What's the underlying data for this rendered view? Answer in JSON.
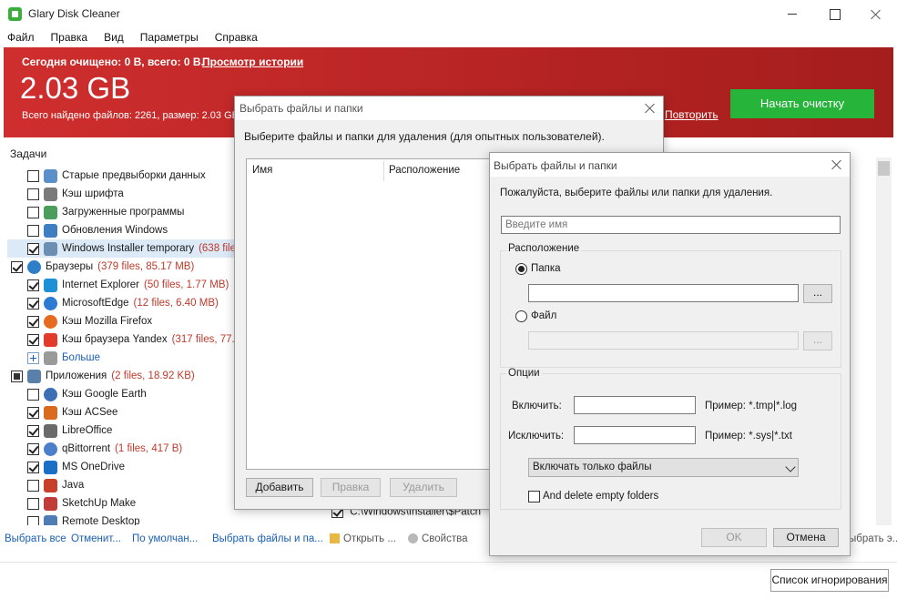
{
  "app": {
    "title": "Glary Disk Cleaner"
  },
  "menu": [
    "Файл",
    "Правка",
    "Вид",
    "Параметры",
    "Справка"
  ],
  "banner": {
    "today": "Сегодня очищено: 0 B, всего: 0 B.",
    "history_link": "Просмотр истории",
    "total_size": "2.03 GB",
    "found": "Всего найдено файлов: 2261, размер: 2.03 GB",
    "repeat_link": "Повторить",
    "start_button": "Начать очистку"
  },
  "tasks": {
    "header": "Задачи",
    "rows": [
      {
        "label": "Старые предвыборки данных",
        "count": "",
        "checked": false,
        "indent": 1,
        "icon": "prefetch-icon",
        "color": "#5b8fc9"
      },
      {
        "label": "Кэш шрифта",
        "count": "",
        "checked": false,
        "indent": 1,
        "icon": "font-icon",
        "color": "#7a7a7a"
      },
      {
        "label": "Загруженные программы",
        "count": "",
        "checked": false,
        "indent": 1,
        "icon": "download-icon",
        "color": "#4a9d5a"
      },
      {
        "label": "Обновления Windows",
        "count": "",
        "checked": false,
        "indent": 1,
        "icon": "windows-update-icon",
        "color": "#3f7fc1"
      },
      {
        "label": "Windows Installer temporary",
        "count": "(638 files,",
        "checked": true,
        "indent": 1,
        "icon": "installer-icon",
        "color": "#6a8fb3",
        "selected": true
      },
      {
        "label": "Браузеры",
        "count": "(379 files, 85.17 MB)",
        "checked": true,
        "indent": 0,
        "icon": "globe-icon",
        "color": "#2e7fc7"
      },
      {
        "label": "Internet Explorer",
        "count": "(50 files, 1.77 MB)",
        "checked": true,
        "indent": 1,
        "icon": "ie-icon",
        "color": "#1e90d6"
      },
      {
        "label": "MicrosoftEdge",
        "count": "(12 files, 6.40 MB)",
        "checked": true,
        "indent": 1,
        "icon": "edge-icon",
        "color": "#2a7bd1"
      },
      {
        "label": "Кэш Mozilla Firefox",
        "count": "",
        "checked": true,
        "indent": 1,
        "icon": "firefox-icon",
        "color": "#e66a1f"
      },
      {
        "label": "Кэш браузера Yandex",
        "count": "(317 files, 77.0",
        "checked": true,
        "indent": 1,
        "icon": "yandex-icon",
        "color": "#e23a2b"
      },
      {
        "label": "Больше",
        "count": "",
        "checked": null,
        "indent": 1,
        "icon": "more-icon",
        "color": "#9a9a9a",
        "link": true
      },
      {
        "label": "Приложения",
        "count": "(2 files, 18.92 KB)",
        "checked": "partial",
        "indent": 0,
        "icon": "apps-icon",
        "color": "#5a7fa8"
      },
      {
        "label": "Кэш Google Earth",
        "count": "",
        "checked": false,
        "indent": 1,
        "icon": "google-earth-icon",
        "color": "#3d6fb5"
      },
      {
        "label": "Кэш ACSee",
        "count": "",
        "checked": true,
        "indent": 1,
        "icon": "acdsee-icon",
        "color": "#d96b1e"
      },
      {
        "label": "LibreOffice",
        "count": "",
        "checked": true,
        "indent": 1,
        "icon": "libreoffice-icon",
        "color": "#6a6a6a"
      },
      {
        "label": "qBittorrent",
        "count": "(1 files, 417 B)",
        "checked": true,
        "indent": 1,
        "icon": "qbittorrent-icon",
        "color": "#4b7fc9"
      },
      {
        "label": "MS OneDrive",
        "count": "",
        "checked": true,
        "indent": 1,
        "icon": "onedrive-icon",
        "color": "#1b6fc7"
      },
      {
        "label": "Java",
        "count": "",
        "checked": false,
        "indent": 1,
        "icon": "java-icon",
        "color": "#c8402a"
      },
      {
        "label": "SketchUp Make",
        "count": "",
        "checked": false,
        "indent": 1,
        "icon": "sketchup-icon",
        "color": "#c23b3b"
      },
      {
        "label": "Remote Desktop",
        "count": "",
        "checked": false,
        "indent": 1,
        "icon": "remote-desktop-icon",
        "color": "#4e7db5"
      }
    ]
  },
  "bottom": {
    "select_all": "Выбрать все",
    "cancel": "Отменит...",
    "default": "По умолчан...",
    "choose_files": "Выбрать файлы и па...",
    "open": "Открыть ...",
    "properties": "Свойства",
    "choose_tail": "ыбрать э...",
    "ignore_list": "Список игнорирования"
  },
  "bg_path": "C:\\Windows\\Installer\\$Patch",
  "dialog1": {
    "title": "Выбрать файлы и папки",
    "description": "Выберите файлы и папки для удаления (для опытных пользователей).",
    "col_name": "Имя",
    "col_location": "Расположение",
    "add": "Добавить",
    "edit": "Правка",
    "delete": "Удалить"
  },
  "dialog2": {
    "title": "Выбрать файлы и папки",
    "description": "Пожалуйста, выберите файлы или папки для удаления.",
    "name_placeholder": "Введите имя",
    "location_label": "Расположение",
    "folder_label": "Папка",
    "folder_value": "",
    "file_label": "Файл",
    "file_value": "",
    "browse": "...",
    "options_label": "Опции",
    "include_label": "Включить:",
    "include_value": "",
    "include_hint": "Пример: *.tmp|*.log",
    "exclude_label": "Исключить:",
    "exclude_value": "",
    "exclude_hint": "Пример: *.sys|*.txt",
    "mode_selected": "Включать только файлы",
    "delete_empty": "And delete empty folders",
    "ok": "OK",
    "cancel": "Отмена"
  }
}
